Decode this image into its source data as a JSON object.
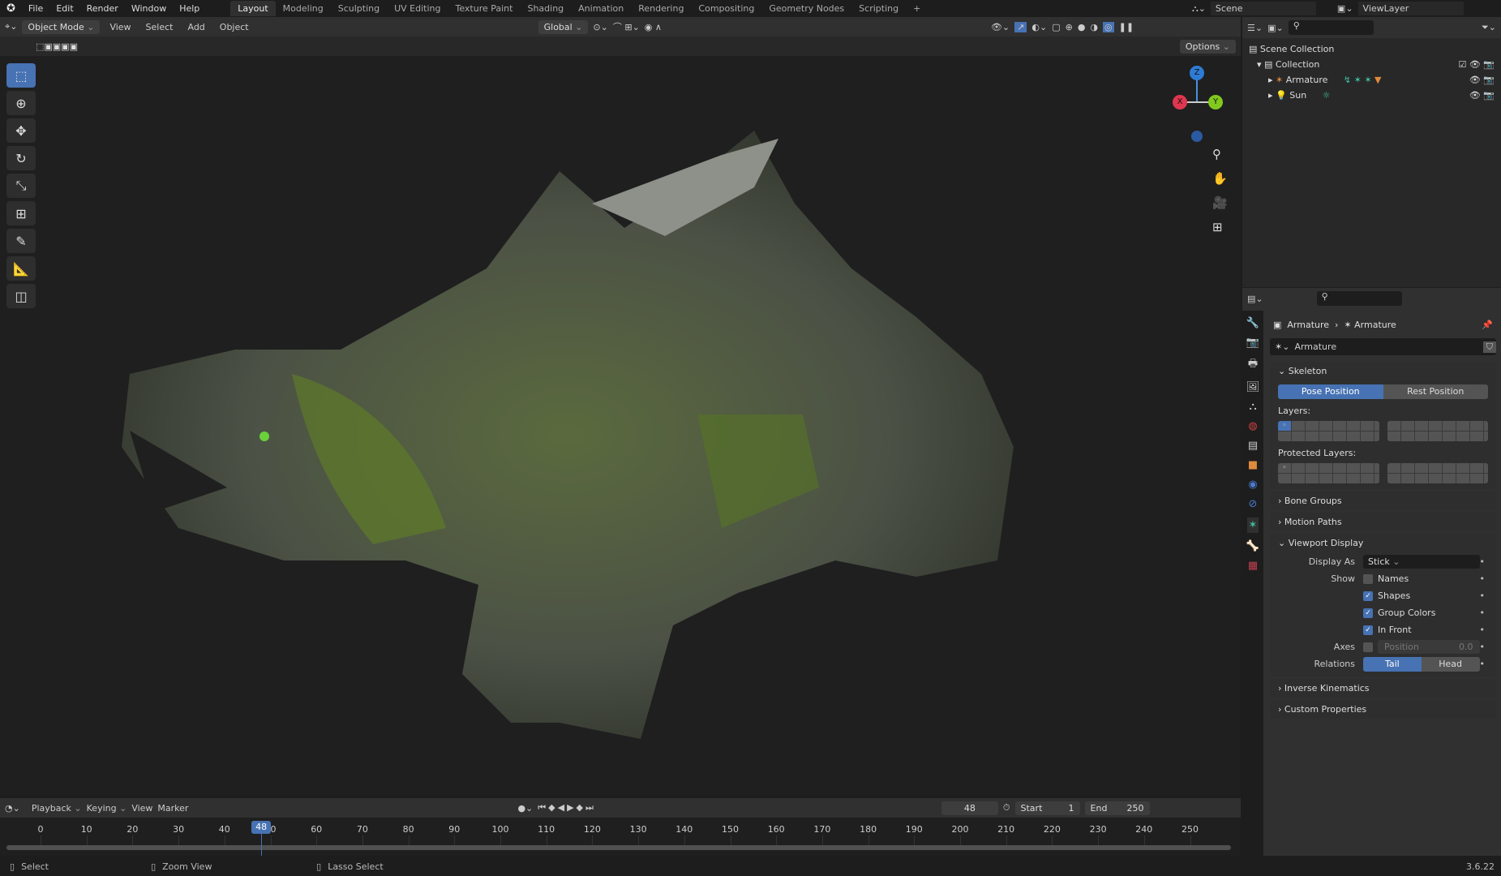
{
  "menu": [
    "File",
    "Edit",
    "Render",
    "Window",
    "Help"
  ],
  "workspaces": [
    "Layout",
    "Modeling",
    "Sculpting",
    "UV Editing",
    "Texture Paint",
    "Shading",
    "Animation",
    "Rendering",
    "Compositing",
    "Geometry Nodes",
    "Scripting",
    "+"
  ],
  "scene": "Scene",
  "view_layer": "ViewLayer",
  "viewport": {
    "mode": "Object Mode",
    "menus": [
      "View",
      "Select",
      "Add",
      "Object"
    ],
    "orientation": "Global",
    "options": "Options",
    "gizmo": {
      "x": "X",
      "y": "Y",
      "z": "Z"
    }
  },
  "outliner": {
    "root": "Scene Collection",
    "collection": "Collection",
    "items": [
      "Armature",
      "Sun"
    ]
  },
  "properties": {
    "breadcrumb": [
      "Armature",
      "Armature"
    ],
    "data_name": "Armature",
    "skeleton": {
      "title": "Skeleton",
      "pose": "Pose Position",
      "rest": "Rest Position",
      "layers": "Layers:",
      "protected": "Protected Layers:"
    },
    "collapsed": [
      "Bone Groups",
      "Motion Paths"
    ],
    "viewport_display": {
      "title": "Viewport Display",
      "display_as_label": "Display As",
      "display_as": "Stick",
      "show_label": "Show",
      "names": "Names",
      "shapes": "Shapes",
      "group_colors": "Group Colors",
      "in_front": "In Front",
      "axes_label": "Axes",
      "position": "Position",
      "position_value": "0.0",
      "relations_label": "Relations",
      "tail": "Tail",
      "head": "Head"
    },
    "bottom_sections": [
      "Inverse Kinematics",
      "Custom Properties"
    ]
  },
  "timeline": {
    "menus": [
      "Playback",
      "Keying",
      "View",
      "Marker"
    ],
    "current_frame": "48",
    "start_label": "Start",
    "start": "1",
    "end_label": "End",
    "end": "250",
    "ticks": [
      "0",
      "10",
      "20",
      "30",
      "40",
      "50",
      "60",
      "70",
      "80",
      "90",
      "100",
      "110",
      "120",
      "130",
      "140",
      "150",
      "160",
      "170",
      "180",
      "190",
      "200",
      "210",
      "220",
      "230",
      "240",
      "250"
    ]
  },
  "status": {
    "items": [
      "Select",
      "Zoom View",
      "Lasso Select"
    ],
    "version": "3.6.22"
  }
}
